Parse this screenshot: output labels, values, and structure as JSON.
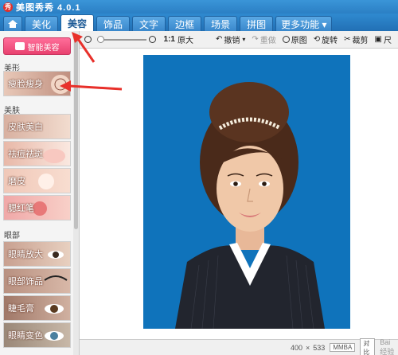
{
  "window": {
    "title": "美图秀秀 4.0.1",
    "logo_text": "秀"
  },
  "tabs": [
    {
      "label": "美化"
    },
    {
      "label": "美容"
    },
    {
      "label": "饰品"
    },
    {
      "label": "文字"
    },
    {
      "label": "边框"
    },
    {
      "label": "场景"
    },
    {
      "label": "拼图"
    },
    {
      "label": "更多功能 ▾"
    }
  ],
  "sidebar": {
    "smart_button": "智能美容",
    "sections": [
      {
        "title": "美形",
        "items": [
          {
            "label": "瘦脸瘦身"
          }
        ]
      },
      {
        "title": "美肤",
        "items": [
          {
            "label": "皮肤美白"
          },
          {
            "label": "祛痘祛斑"
          },
          {
            "label": "磨皮"
          },
          {
            "label": "腮红笔"
          }
        ]
      },
      {
        "title": "眼部",
        "items": [
          {
            "label": "眼睛放大"
          },
          {
            "label": "眼部饰品"
          },
          {
            "label": "睫毛膏"
          },
          {
            "label": "眼睛变色"
          }
        ]
      }
    ]
  },
  "toolbar": {
    "zoom_actual": "1:1",
    "zoom_actual_label": "原大",
    "undo": "撤销",
    "redo": "重做",
    "original": "原图",
    "rotate": "旋转",
    "crop": "裁剪",
    "size": "尺"
  },
  "status": {
    "width": "400",
    "sep": "×",
    "height": "533",
    "badge": "MMBA",
    "compare": "对比",
    "watermark": "Bai 经验"
  },
  "colors": {
    "accent": "#2b7fc4",
    "photo_bg": "#0f73bb",
    "smart_button": "#e8416f",
    "annotation_arrow": "#e8302a"
  }
}
